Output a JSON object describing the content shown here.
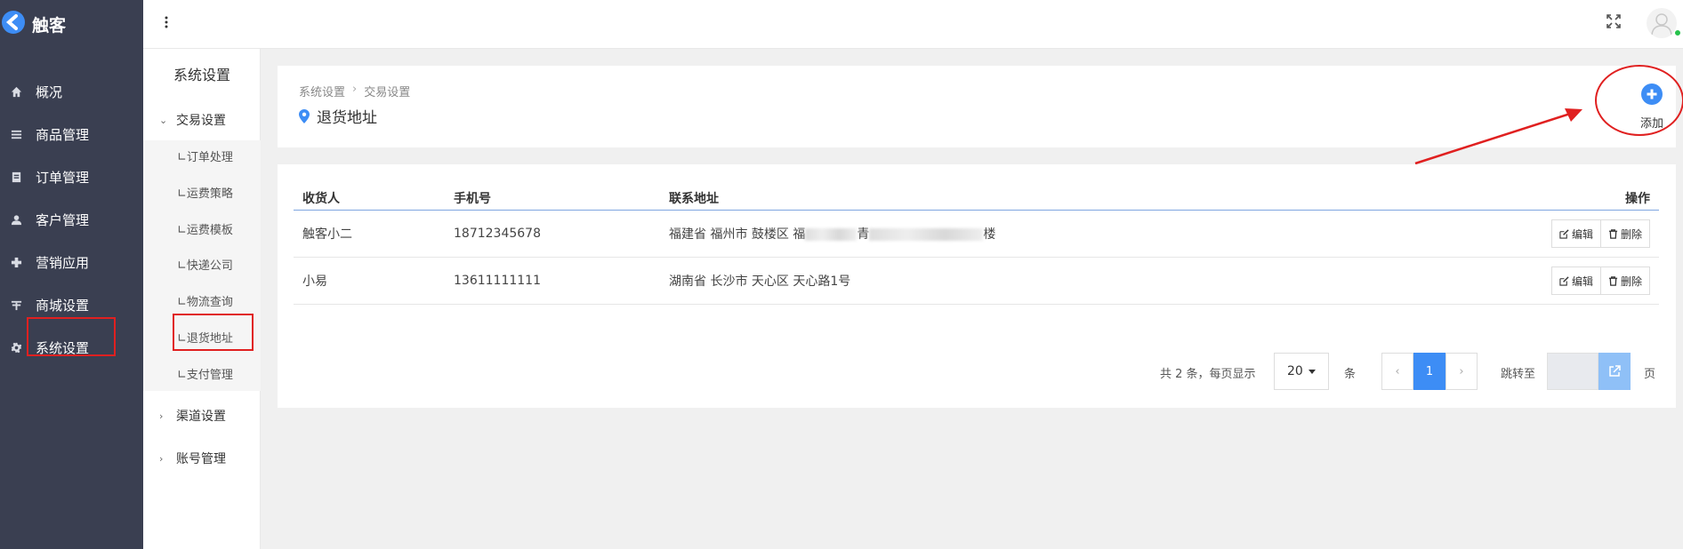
{
  "brand": {
    "name": "触客"
  },
  "colors": {
    "accent": "#3d8df5",
    "sidebar_bg": "#3a3f51",
    "highlight": "#e02020",
    "online": "#27c24c"
  },
  "sidebar": {
    "items": [
      {
        "label": "概况",
        "icon": "home-icon"
      },
      {
        "label": "商品管理",
        "icon": "list-icon"
      },
      {
        "label": "订单管理",
        "icon": "order-icon"
      },
      {
        "label": "客户管理",
        "icon": "user-icon"
      },
      {
        "label": "营销应用",
        "icon": "puzzle-icon"
      },
      {
        "label": "商城设置",
        "icon": "shop-icon"
      },
      {
        "label": "系统设置",
        "icon": "gear-icon"
      }
    ]
  },
  "submenu": {
    "title": "系统设置",
    "groups": [
      {
        "label": "交易设置",
        "expanded": true
      },
      {
        "label": "渠道设置",
        "expanded": false
      },
      {
        "label": "账号管理",
        "expanded": false
      }
    ],
    "items": [
      {
        "label": "∟订单处理"
      },
      {
        "label": "∟运费策略"
      },
      {
        "label": "∟运费模板"
      },
      {
        "label": "∟快递公司"
      },
      {
        "label": "∟物流查询"
      },
      {
        "label": "∟退货地址"
      },
      {
        "label": "∟支付管理"
      }
    ]
  },
  "header": {
    "breadcrumb": [
      "系统设置",
      "交易设置"
    ],
    "breadcrumb_sep": "›",
    "title": "退货地址",
    "add_label": "添加"
  },
  "table": {
    "columns": {
      "name": "收货人",
      "phone": "手机号",
      "address": "联系地址",
      "ops": "操作"
    },
    "rows": [
      {
        "name": "触客小二",
        "phone": "18712345678",
        "address": "福建省 福州市 鼓楼区 福",
        "address_mid": "青",
        "address_end": "楼"
      },
      {
        "name": "小易",
        "phone": "13611111111",
        "address": "湖南省 长沙市 天心区 天心路1号",
        "address_mid": "",
        "address_end": ""
      }
    ],
    "edit_label": "编辑",
    "delete_label": "删除"
  },
  "pagination": {
    "total_text": "共 2 条，每页显示",
    "page_size": "20",
    "unit": "条",
    "prev": "‹",
    "current_page": "1",
    "next": "›",
    "jump_label": "跳转至",
    "page_unit": "页"
  }
}
